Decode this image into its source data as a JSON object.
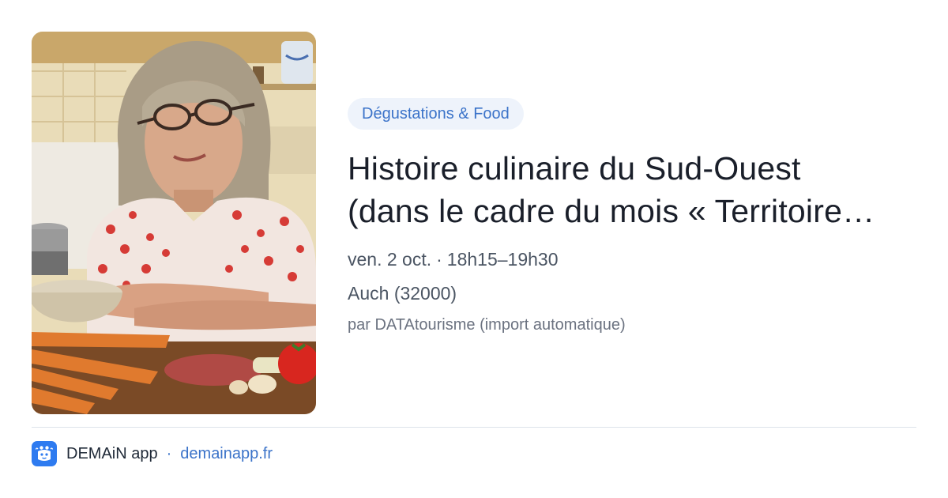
{
  "event": {
    "category": "Dégustations & Food",
    "title_line1": "Histoire culinaire du Sud-Ouest",
    "title_line2": "(dans le cadre du mois « Territoire…",
    "date": "ven. 2 oct.",
    "separator": "·",
    "time": "18h15–19h30",
    "location": "Auch (32000)",
    "source": "par DATAtourisme (import automatique)"
  },
  "footer": {
    "app_name": "DEMAiN app",
    "separator": "·",
    "link_text": "demainapp.fr"
  },
  "colors": {
    "accent": "#3b73c9",
    "tag_background": "#eef3fb",
    "app_icon": "#2e7bf0"
  },
  "icons": {
    "footer_logo": "demain-app-logo-icon"
  }
}
